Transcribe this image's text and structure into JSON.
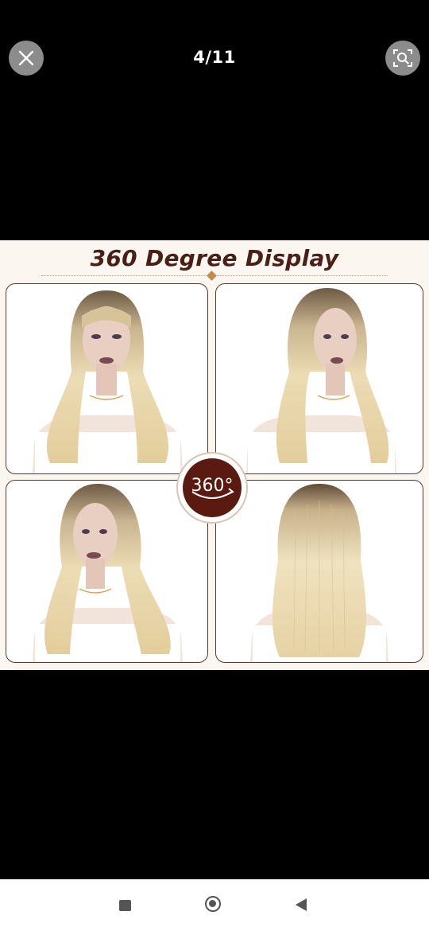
{
  "viewer": {
    "counter": "4/11",
    "close_icon": "close-icon",
    "lens_icon": "image-search-icon"
  },
  "product_image": {
    "title": "360 Degree Display",
    "badge_text": "360°",
    "title_color": "#4a1f17",
    "badge_color": "#5a1a10",
    "panels": [
      "wig-front-view",
      "wig-right-side-view",
      "wig-left-side-view",
      "wig-back-view"
    ]
  },
  "navigation": {
    "recents_icon": "recents-square-icon",
    "home_icon": "home-circle-icon",
    "back_icon": "back-triangle-icon"
  }
}
